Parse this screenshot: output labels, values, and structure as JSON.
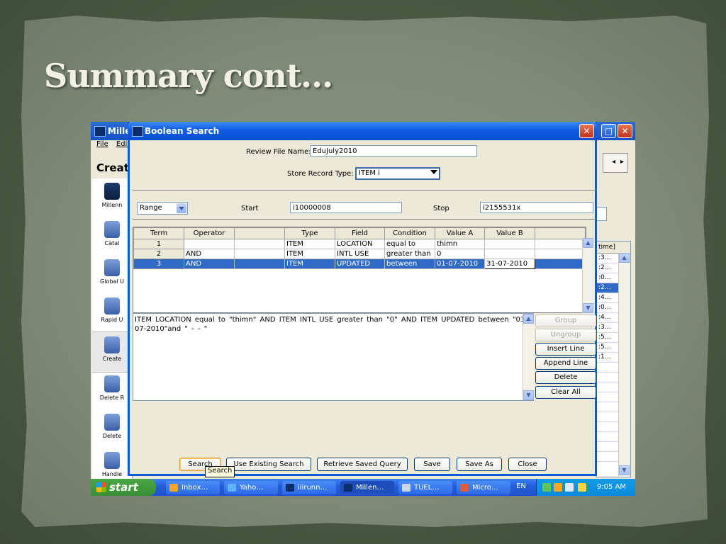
{
  "slide": {
    "title": "Summary cont…"
  },
  "background_app": {
    "title": "Mille",
    "menu": [
      "File",
      "Edit"
    ],
    "heading": "Creat",
    "nav_items": [
      {
        "label": "Millenn"
      },
      {
        "label": "Catal"
      },
      {
        "label": "Global U"
      },
      {
        "label": "Rapid U"
      },
      {
        "label": "Create"
      },
      {
        "label": "Delete R"
      },
      {
        "label": "Delete"
      },
      {
        "label": "Handle"
      }
    ],
    "right_column": {
      "header": "time]",
      "cells": [
        ":3…",
        ":2…",
        ":0…",
        ":2…",
        ":4…",
        ":0…",
        ":4…",
        ":3…",
        ":5…",
        ":5…",
        ":1…"
      ],
      "selected_index": 3
    }
  },
  "dialog": {
    "title": "Boolean Search",
    "review_file_label": "Review File Name:",
    "review_file_value": "EduJuly2010",
    "store_type_label": "Store Record Type:",
    "store_type_value": "ITEM i",
    "range": {
      "mode": "Range",
      "start_label": "Start",
      "start_value": "i10000008",
      "stop_label": "Stop",
      "stop_value": "i2155531x"
    },
    "grid": {
      "columns": [
        "Term",
        "Operator",
        "",
        "Type",
        "Field",
        "Condition",
        "Value A",
        "Value B",
        ""
      ],
      "rows": [
        {
          "term": "1",
          "operator": "",
          "type": "ITEM",
          "field": "LOCATION",
          "condition": "equal to",
          "value_a": "thimn",
          "value_b": ""
        },
        {
          "term": "2",
          "operator": "AND",
          "type": "ITEM",
          "field": "INTL USE",
          "condition": "greater than",
          "value_a": "0",
          "value_b": ""
        },
        {
          "term": "3",
          "operator": "AND",
          "type": "ITEM",
          "field": "UPDATED",
          "condition": "between",
          "value_a": "01-07-2010",
          "value_b": "31-07-2010"
        }
      ],
      "selected_row": 3
    },
    "query_text": "ITEM LOCATION equal to \"thimn\"   AND ITEM INTL USE  greater than \"0\"   AND ITEM UPDATED between \"01-07-2010\"and \" - - \"",
    "side_buttons": {
      "group": "Group",
      "ungroup": "Ungroup",
      "insert_line": "Insert Line",
      "append_line": "Append Line",
      "delete": "Delete",
      "clear_all": "Clear All"
    },
    "bottom_buttons": {
      "search": "Search",
      "use_existing": "Use Existing Search",
      "retrieve": "Retrieve Saved Query",
      "save": "Save",
      "save_as": "Save As",
      "close": "Close"
    },
    "tooltip": "Search"
  },
  "taskbar": {
    "start": "start",
    "tasks": [
      "Inbox…",
      "Yaho…",
      "iiirunn…",
      "Millen…",
      "TUEL…",
      "Micro…"
    ],
    "active_task": 3,
    "language": "EN",
    "clock": "9:05 AM"
  }
}
